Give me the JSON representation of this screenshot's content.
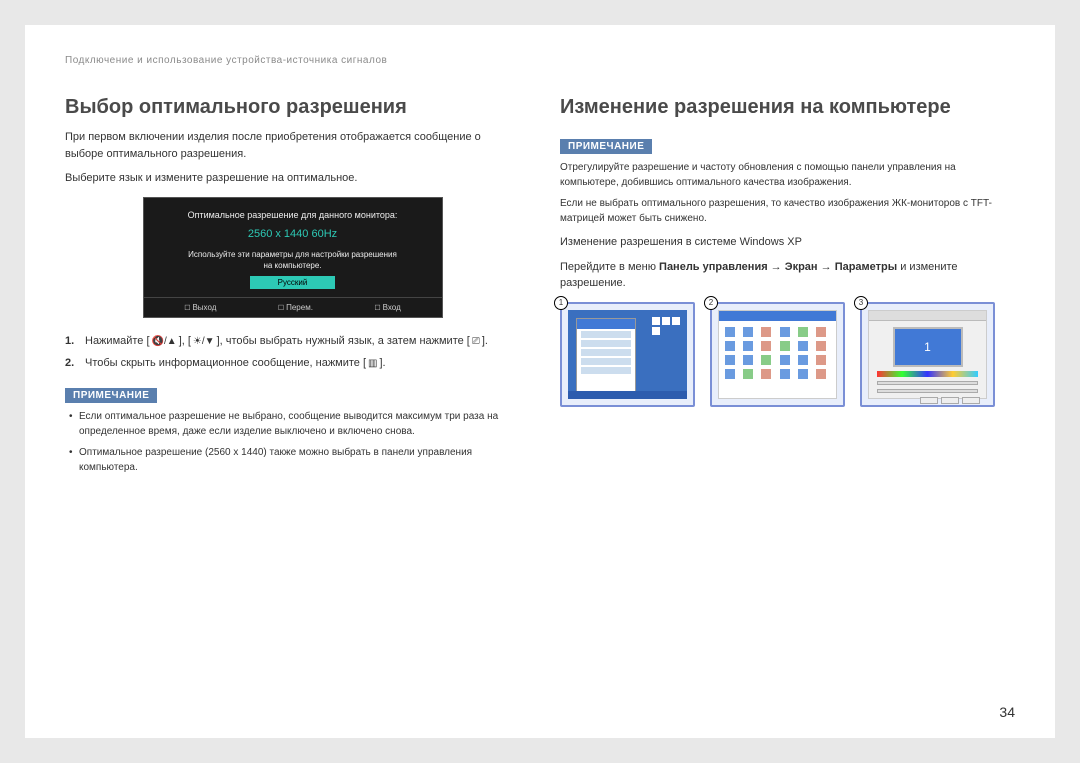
{
  "breadcrumb": "Подключение и использование устройства-источника сигналов",
  "left": {
    "heading": "Выбор оптимального разрешения",
    "p1": "При первом включении изделия после приобретения отображается сообщение о выборе оптимального разрешения.",
    "p2": "Выберите язык и измените разрешение на оптимальное.",
    "osd": {
      "line1": "Оптимальное разрешение для данного монитора:",
      "resolution": "2560 x 1440  60Hz",
      "line2": "Используйте эти параметры для настройки разрешения",
      "line3": "на компьютере.",
      "lang": "Русский",
      "exit": "Выход",
      "move": "Перем.",
      "enter": "Вход"
    },
    "step1_a": "Нажимайте [",
    "step1_b": "], [",
    "step1_c": "], чтобы выбрать нужный язык, а затем нажмите [",
    "step1_d": "].",
    "step2_a": "Чтобы скрыть информационное сообщение, нажмите [",
    "step2_b": "].",
    "note_label": "ПРИМЕЧАНИЕ",
    "note1": "Если оптимальное разрешение не выбрано, сообщение выводится максимум три раза на определенное время, даже если изделие выключено и включено снова.",
    "note2": "Оптимальное разрешение (2560 x 1440) также можно выбрать в панели управления компьютера."
  },
  "right": {
    "heading": "Изменение разрешения на компьютере",
    "note_label": "ПРИМЕЧАНИЕ",
    "p1": "Отрегулируйте разрешение и частоту обновления с помощью панели управления на компьютере, добившись оптимального качества изображения.",
    "p2": "Если не выбрать оптимального разрешения, то качество изображения ЖК-мониторов с TFT-матрицей может быть снижено.",
    "p3": "Изменение разрешения в системе Windows XP",
    "p4_a": "Перейдите в меню ",
    "p4_b": "Панель управления",
    "p4_arrow1": " → ",
    "p4_c": "Экран",
    "p4_arrow2": " → ",
    "p4_d": "Параметры",
    "p4_e": " и измените разрешение.",
    "thumb1": "1",
    "thumb2": "2",
    "thumb3": "3",
    "monitor_num": "1"
  },
  "page_number": "34"
}
